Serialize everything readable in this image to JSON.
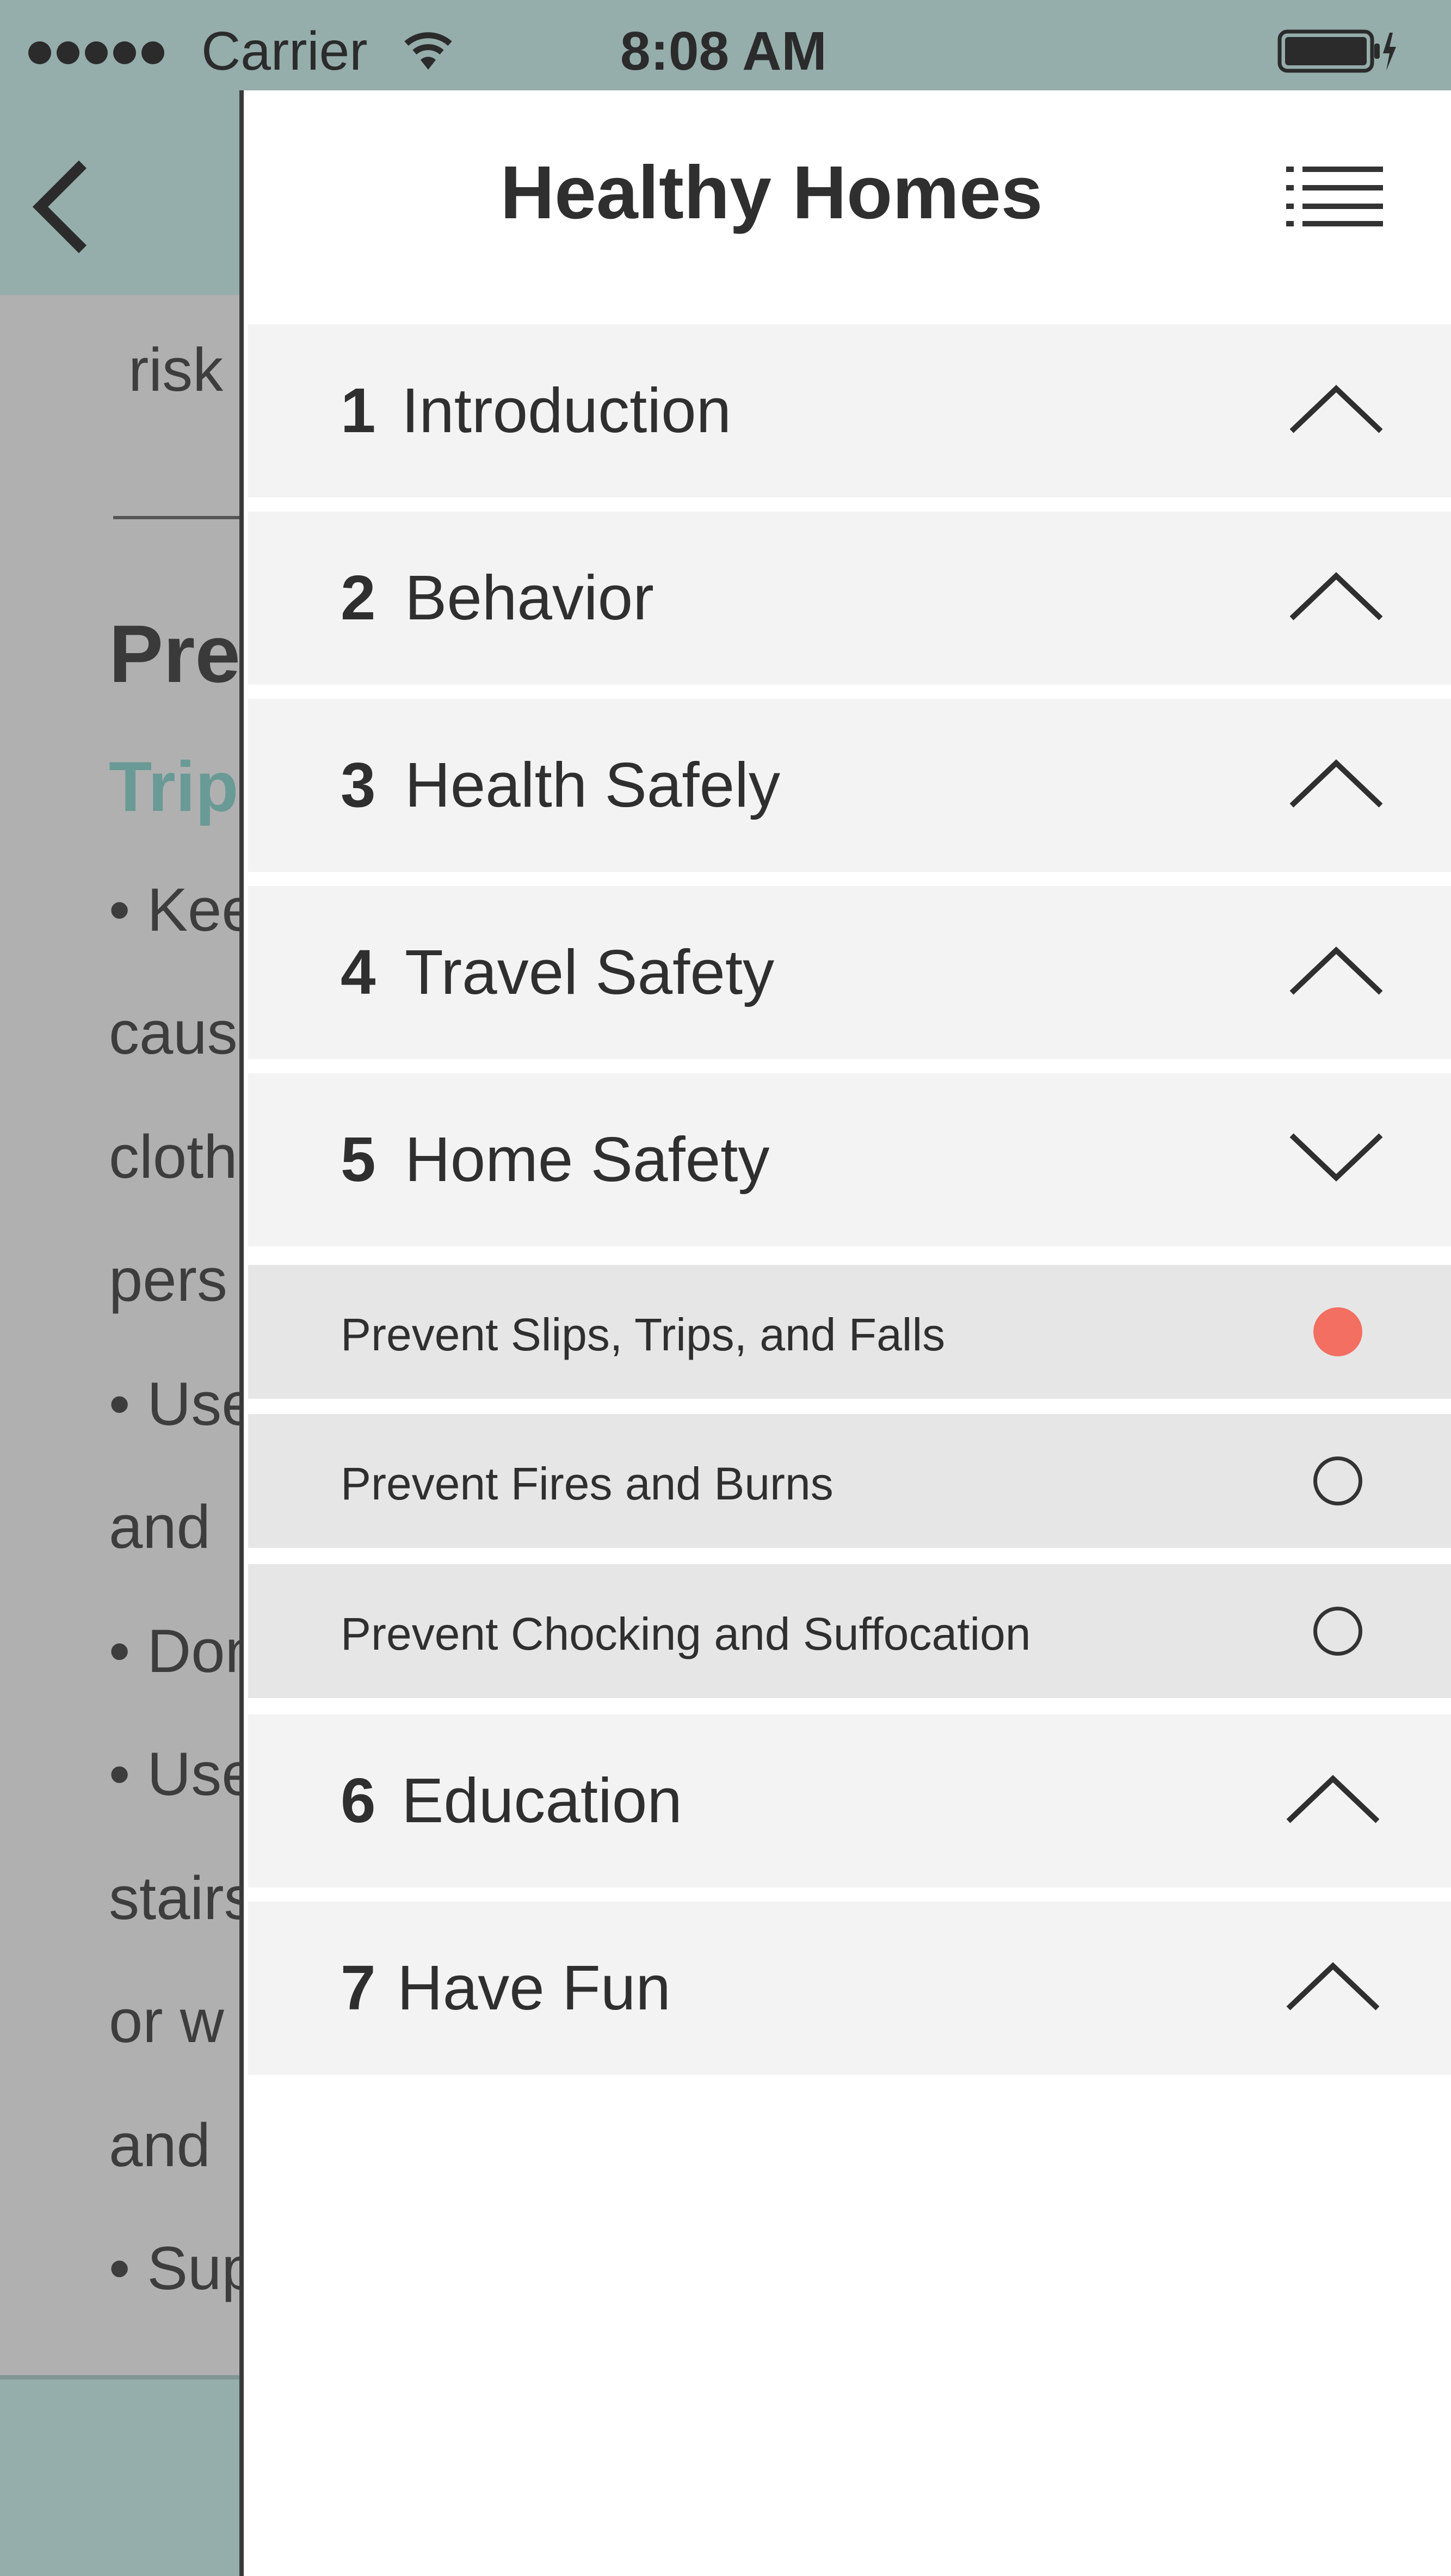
{
  "status_bar": {
    "carrier": "Carrier",
    "time": "8:08 AM",
    "signal_icon": "signal-dots-icon",
    "wifi_icon": "wifi-icon",
    "battery_icon": "battery-charging-icon"
  },
  "background_page": {
    "back_icon": "chevron-left-icon",
    "lines": [
      "risk",
      "Pre",
      "Trip",
      "• Kee",
      "caus",
      "cloth",
      "pers",
      "• Use",
      "and",
      "• Don",
      "• Use",
      "stairs",
      "or w",
      "and",
      "• Sup"
    ]
  },
  "drawer": {
    "title": "Healthy Homes",
    "menu_icon": "list-menu-icon",
    "sections": [
      {
        "number": "1",
        "title": "Introduction",
        "expanded": false
      },
      {
        "number": "2",
        "title": "Behavior",
        "expanded": false
      },
      {
        "number": "3",
        "title": "Health Safely",
        "expanded": false
      },
      {
        "number": "4",
        "title": "Travel Safety",
        "expanded": false
      },
      {
        "number": "5",
        "title": "Home Safety",
        "expanded": true
      },
      {
        "number": "6",
        "title": "Education",
        "expanded": false
      },
      {
        "number": "7",
        "title": "Have Fun",
        "expanded": false
      }
    ],
    "home_safety_items": [
      {
        "label": "Prevent Slips, Trips, and Falls",
        "selected": true
      },
      {
        "label": "Prevent Fires and Burns",
        "selected": false
      },
      {
        "label": "Prevent Chocking and Suffocation",
        "selected": false
      }
    ]
  },
  "colors": {
    "header_teal": "#95adab",
    "accent_teal": "#6a9a96",
    "selected_indicator": "#f26f61",
    "section_bg": "#f3f3f3",
    "sub_item_bg": "#e6e6e6"
  }
}
